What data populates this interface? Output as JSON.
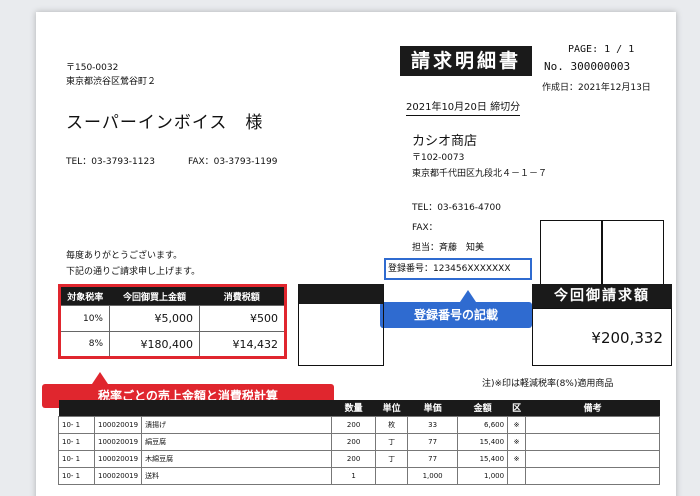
{
  "header": {
    "title": "請求明細書",
    "page": "PAGE: 1 / 1",
    "number": "No. 300000003",
    "created": "作成日：2021年12月13日",
    "cutoff": "2021年10月20日 締切分"
  },
  "customer": {
    "postal": "〒150-0032",
    "address": "東京都渋谷区鶯谷町２",
    "name": "スーパーインボイス　様",
    "tel": "TEL：03-3793-1123",
    "fax": "FAX：03-3793-1199"
  },
  "issuer": {
    "name": "カシオ商店",
    "postal": "〒102-0073",
    "address": "東京都千代田区九段北４－１－７",
    "tel": "TEL：03-6316-4700",
    "fax": "FAX：",
    "staff": "担当：斉藤　知美",
    "registration": "登録番号：123456XXXXXXX"
  },
  "greeting": {
    "line1": "毎度ありがとうございます。",
    "line2": "下記の通りご請求申し上げます。"
  },
  "tax_table": {
    "headers": [
      "対象税率",
      "今回御買上金額",
      "消費税額"
    ],
    "rows": [
      [
        "10%",
        "¥5,000",
        "¥500"
      ],
      [
        "8%",
        "¥180,400",
        "¥14,432"
      ]
    ]
  },
  "total": {
    "label": "今回御請求額",
    "value": "¥200,332"
  },
  "callouts": {
    "registration": "登録番号の記載",
    "tax": "税率ごとの売上金額と消費税計算"
  },
  "note": "注)※印は軽減税率(8%)適用商品",
  "detail": {
    "headers": [
      "",
      "",
      "",
      "数量",
      "単位",
      "単価",
      "金額",
      "区",
      "備考"
    ],
    "rows": [
      [
        "10- 1",
        "100020019",
        "漬揚げ",
        "200",
        "枚",
        "33",
        "6,600",
        "※",
        ""
      ],
      [
        "10- 1",
        "100020019",
        "絹豆腐",
        "200",
        "丁",
        "77",
        "15,400",
        "※",
        ""
      ],
      [
        "10- 1",
        "100020019",
        "木綿豆腐",
        "200",
        "丁",
        "77",
        "15,400",
        "※",
        ""
      ],
      [
        "10- 1",
        "100020019",
        "送料",
        "1",
        "",
        "1,000",
        "1,000",
        "",
        ""
      ]
    ]
  }
}
